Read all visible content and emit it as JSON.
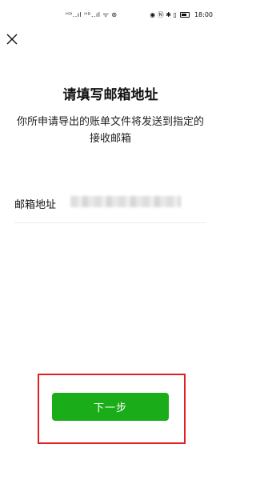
{
  "status_bar": {
    "left_text": "ᴴᴰ..ıl ᴴᴰ..ıl ᯤ ⊛",
    "right_icons": "◉ Ⓝ ✱ ▯",
    "time": "18:00"
  },
  "header": {
    "close_icon": "close-icon"
  },
  "main": {
    "title": "请填写邮箱地址",
    "description": "你所申请导出的账单文件将发送到指定的接收邮箱",
    "email_label": "邮箱地址",
    "email_value": ""
  },
  "footer": {
    "next_label": "下一步"
  },
  "colors": {
    "accent": "#1aad19",
    "highlight": "#e02020"
  }
}
